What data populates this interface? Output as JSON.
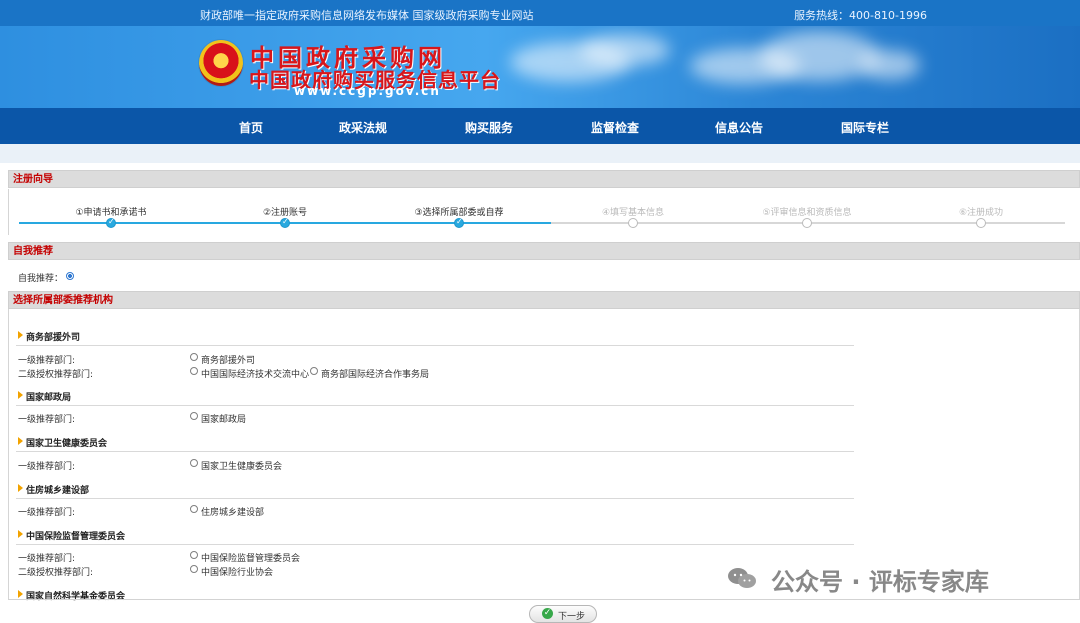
{
  "top_bar": {
    "left_text": "财政部唯一指定政府采购信息网络发布媒体 国家级政府采购专业网站",
    "hotline": "服务热线：400-810-1996"
  },
  "banner": {
    "logo_line1": "中国政府采购网",
    "logo_line2": "中国政府购买服务信息平台",
    "website": "www.ccgp.gov.cn"
  },
  "nav": {
    "items": [
      "首页",
      "政采法规",
      "购买服务",
      "监督检查",
      "信息公告",
      "国际专栏"
    ]
  },
  "registration_guide": {
    "title": "注册向导",
    "steps": [
      {
        "label": "①申请书和承诺书",
        "status": "done"
      },
      {
        "label": "②注册账号",
        "status": "done"
      },
      {
        "label": "③选择所属部委或自荐",
        "status": "done"
      },
      {
        "label": "④填写基本信息",
        "status": "future"
      },
      {
        "label": "⑤评审信息和资质信息",
        "status": "future"
      },
      {
        "label": "⑥注册成功",
        "status": "future"
      }
    ]
  },
  "self_recommendation": {
    "title": "自我推荐",
    "label": "自我推荐："
  },
  "recommendation_section": {
    "title": "选择所属部委推荐机构",
    "groups": [
      {
        "name": "商务部援外司",
        "rows": [
          {
            "label": "一级推荐部门:",
            "options": [
              "商务部援外司"
            ]
          },
          {
            "label": "二级授权推荐部门:",
            "options": [
              "中国国际经济技术交流中心",
              "商务部国际经济合作事务局"
            ]
          }
        ]
      },
      {
        "name": "国家邮政局",
        "rows": [
          {
            "label": "一级推荐部门:",
            "options": [
              "国家邮政局"
            ]
          }
        ]
      },
      {
        "name": "国家卫生健康委员会",
        "rows": [
          {
            "label": "一级推荐部门:",
            "options": [
              "国家卫生健康委员会"
            ]
          }
        ]
      },
      {
        "name": "住房城乡建设部",
        "rows": [
          {
            "label": "一级推荐部门:",
            "options": [
              "住房城乡建设部"
            ]
          }
        ]
      },
      {
        "name": "中国保险监督管理委员会",
        "rows": [
          {
            "label": "一级推荐部门:",
            "options": [
              "中国保险监督管理委员会"
            ]
          },
          {
            "label": "二级授权推荐部门:",
            "options": [
              "中国保险行业协会"
            ]
          }
        ]
      },
      {
        "name": "国家自然科学基金委员会",
        "rows": []
      }
    ]
  },
  "next_button": {
    "label": "下一步"
  },
  "watermark": {
    "text": "公众号 · 评标专家库"
  }
}
